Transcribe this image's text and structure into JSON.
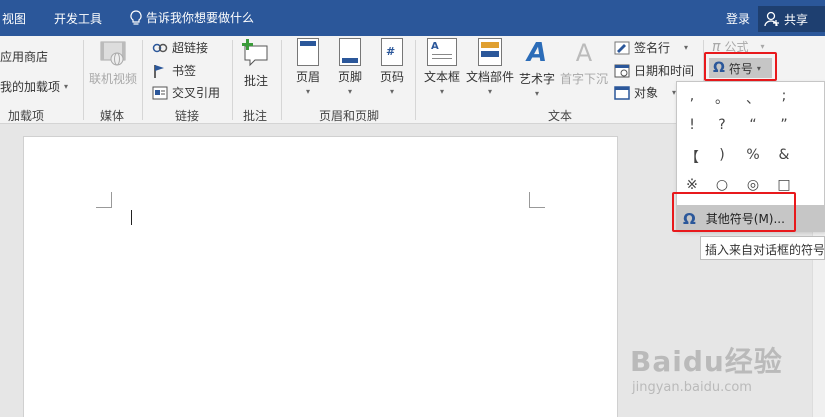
{
  "tabbar": {
    "tabs": [
      "视图",
      "开发工具"
    ],
    "tellme": "告诉我你想要做什么",
    "login": "登录",
    "share": "共享"
  },
  "ribbon": {
    "addins": {
      "store": "应用商店",
      "my_addins": "我的加载项",
      "label": "加载项"
    },
    "media": {
      "online_video": "联机视频",
      "label": "媒体"
    },
    "links": {
      "hyperlink": "超链接",
      "bookmark": "书签",
      "cross_ref": "交叉引用",
      "label": "链接"
    },
    "comments": {
      "comment": "批注",
      "label": "批注"
    },
    "header_footer": {
      "header": "页眉",
      "footer": "页脚",
      "page_number": "页码",
      "label": "页眉和页脚"
    },
    "text": {
      "textbox": "文本框",
      "quickparts": "文档部件",
      "wordart": "艺术字",
      "dropcap": "首字下沉",
      "signature": "签名行",
      "datetime": "日期和时间",
      "object": "对象",
      "label": "文本"
    },
    "symbols": {
      "equation": "公式",
      "symbol": "符号"
    }
  },
  "symbol_dropdown": {
    "symbols": [
      ",",
      "。",
      "、",
      ";",
      "!",
      "?",
      "“",
      "”",
      "【",
      ")",
      "%",
      "&",
      "※",
      "○",
      "◎",
      "□"
    ],
    "more_symbols": "其他符号(M)...",
    "tooltip": "插入来自对话框的符号"
  },
  "watermark": {
    "brand": "Baidu经验",
    "url": "jingyan.baidu.com"
  },
  "colors": {
    "title_bar": "#2b579a",
    "highlight": "#e8191c",
    "selected": "#c6c6c6"
  }
}
